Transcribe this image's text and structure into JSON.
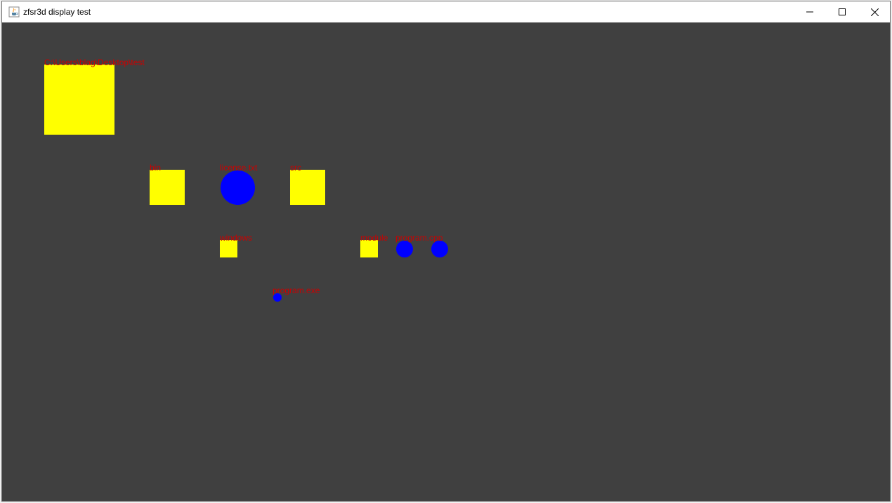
{
  "window": {
    "title": "zfsr3d display test",
    "icon": "java-cup-icon",
    "controls": {
      "minimize_icon": "minimize-icon",
      "maximize_icon": "maximize-icon",
      "close_icon": "close-icon"
    }
  },
  "colors": {
    "background": "#404040",
    "directory": "#ffff00",
    "file": "#0000ff",
    "label": "#cc0000"
  },
  "tree": {
    "root": {
      "label": "C:\\Users\\blag\\Desktop\\test",
      "type": "directory"
    },
    "bin": {
      "label": "bin",
      "type": "directory"
    },
    "license": {
      "label": "license.txt",
      "type": "file"
    },
    "src": {
      "label": "src",
      "type": "directory"
    },
    "windows": {
      "label": "windows",
      "type": "directory"
    },
    "program_exe": {
      "label": "program.exe",
      "type": "file"
    },
    "module": {
      "label": "module",
      "type": "directory"
    },
    "program_file": {
      "label": "program.cpp",
      "type": "file"
    },
    "program_file2": {
      "label": "",
      "type": "file"
    }
  }
}
